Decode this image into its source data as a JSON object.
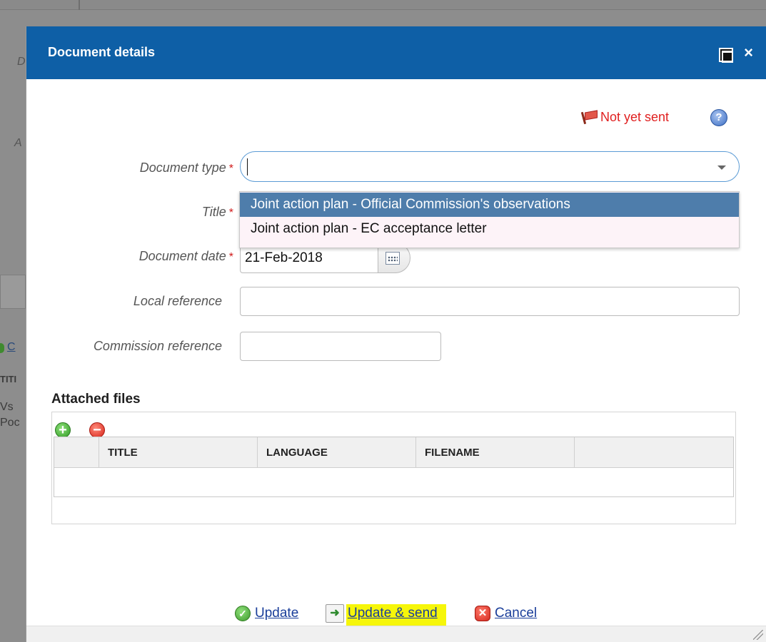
{
  "dialog": {
    "title": "Document details"
  },
  "status": {
    "text": "Not yet sent",
    "color": "#e02020"
  },
  "form": {
    "document_type": {
      "label": "Document type",
      "value": ""
    },
    "title": {
      "label": "Title"
    },
    "document_date": {
      "label": "Document date",
      "value": "21-Feb-2018"
    },
    "local_reference": {
      "label": "Local reference",
      "value": ""
    },
    "commission_reference": {
      "label": "Commission reference",
      "value": ""
    },
    "required_marker": "*"
  },
  "dropdown": {
    "options": [
      "Joint action plan - Official Commission's observations",
      "Joint action plan - EC acceptance letter"
    ]
  },
  "attached_files": {
    "heading": "Attached files",
    "columns": [
      "TITLE",
      "LANGUAGE",
      "FILENAME",
      ""
    ]
  },
  "actions": {
    "update": "Update",
    "update_send": "Update & send",
    "cancel": "Cancel"
  },
  "background": {
    "fragments": [
      "D",
      "A",
      "C",
      "TITI",
      "Vs",
      "Poc"
    ]
  },
  "colors": {
    "titlebar": "#0e5fa6",
    "selected_option": "#4e7dab",
    "highlight": "#f6f60a",
    "link": "#1a3e9a"
  }
}
